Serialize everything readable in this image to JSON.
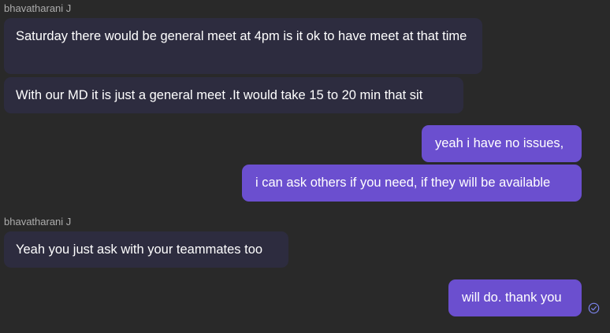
{
  "theme": {
    "background": "#292929",
    "incoming_bubble": "#2d2c3f",
    "outgoing_bubble": "#6b4fcf",
    "text": "#ffffff",
    "sender_text": "#adadad",
    "read_icon": "#7b83eb"
  },
  "messages": [
    {
      "sender": "bhavatharani J",
      "direction": "incoming",
      "text": "Saturday there would be general meet at 4pm is it ok to have meet at that time"
    },
    {
      "direction": "incoming",
      "text": "With our MD it is just a general meet .It would take 15 to 20 min that sit"
    },
    {
      "direction": "outgoing",
      "text": "yeah i have no issues,"
    },
    {
      "direction": "outgoing",
      "text": "i can ask others if you need, if they will be available"
    },
    {
      "sender": "bhavatharani J",
      "direction": "incoming",
      "text": "Yeah you just ask with your teammates too"
    },
    {
      "direction": "outgoing",
      "text": "will do. thank you",
      "status_icon": "read-receipt-icon"
    }
  ]
}
